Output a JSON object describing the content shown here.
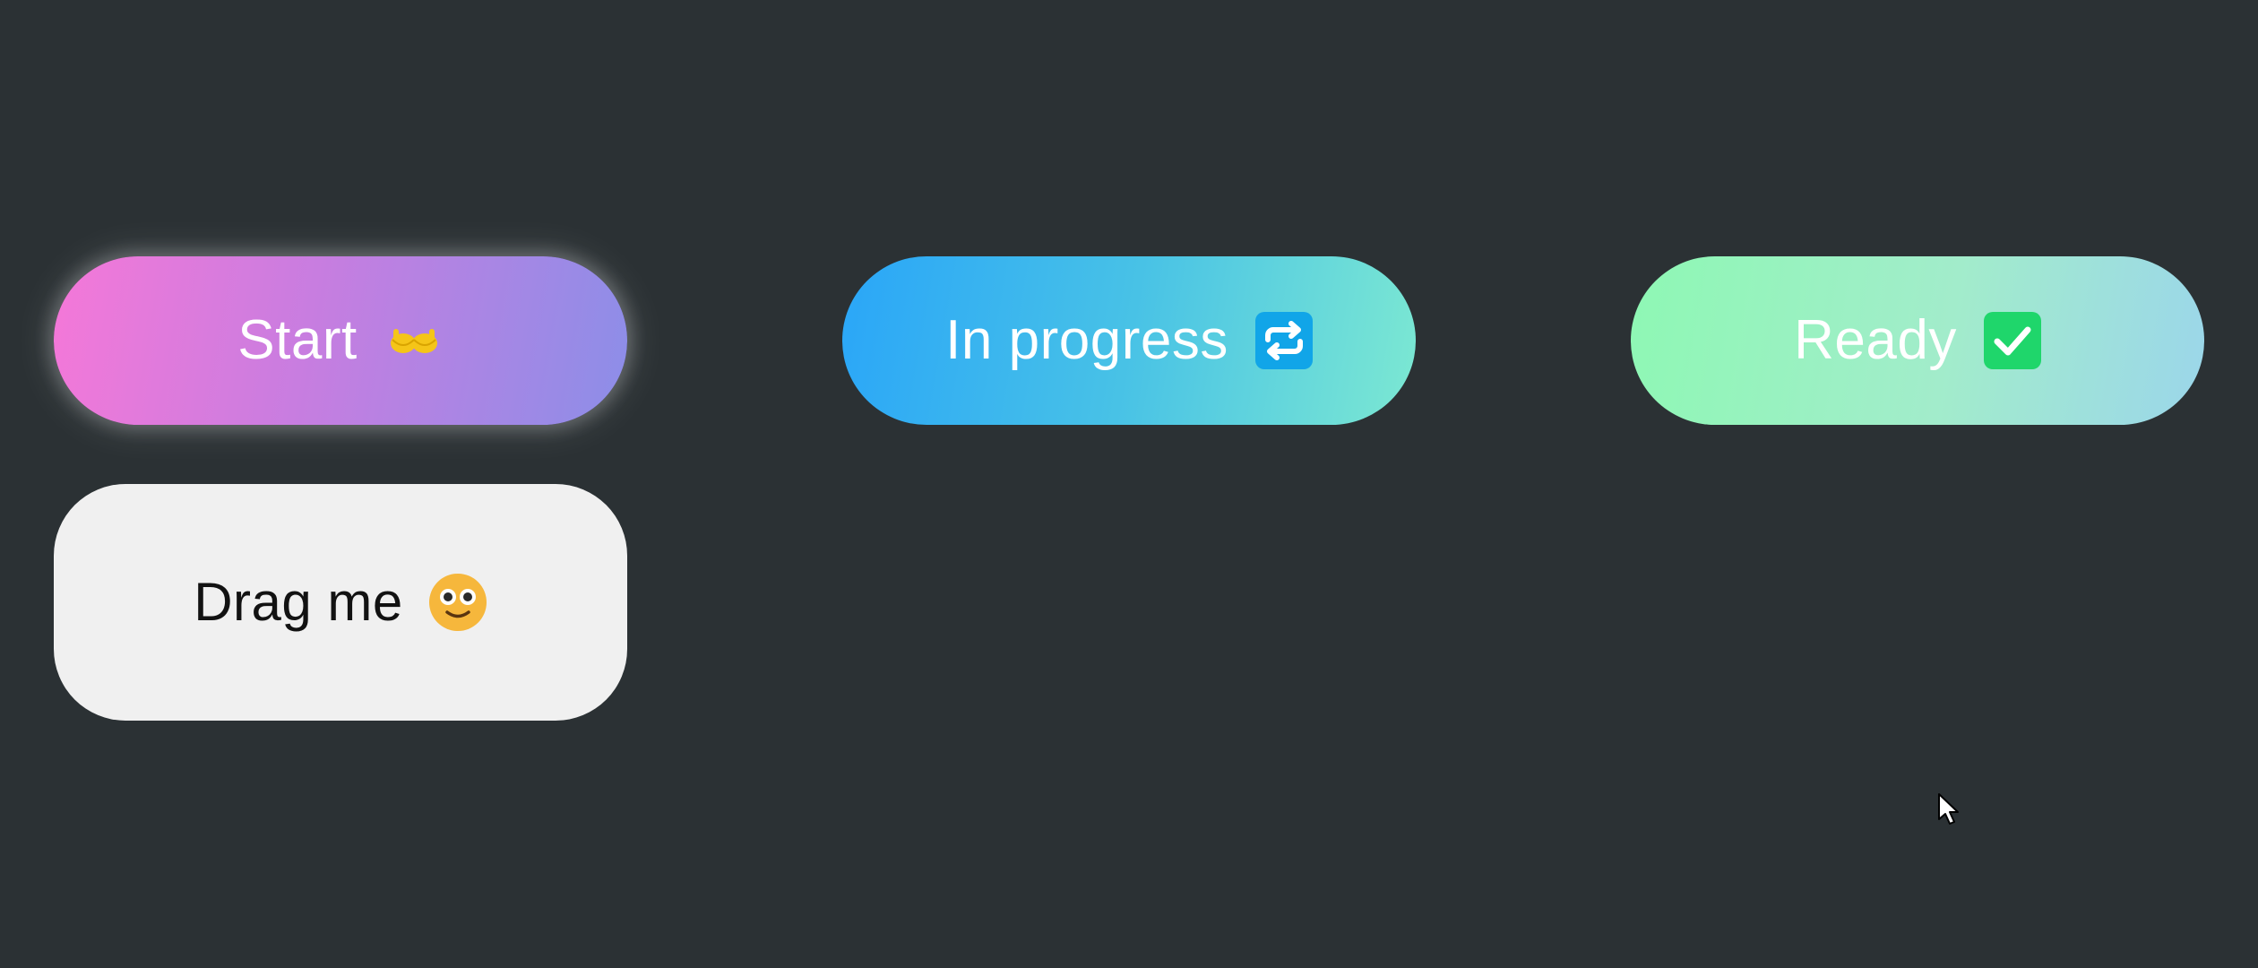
{
  "cards": {
    "start": {
      "label": "Start",
      "icon": "hands-icon"
    },
    "drag": {
      "label": "Drag me",
      "icon": "smiley-face-icon"
    },
    "in_progress": {
      "label": "In progress",
      "icon": "repeat-icon"
    },
    "ready": {
      "label": "Ready",
      "icon": "check-mark-icon"
    }
  },
  "colors": {
    "background": "#2b3134",
    "start_gradient": [
      "#f578d8",
      "#8c8ee8"
    ],
    "in_progress_gradient": [
      "#2aa6f8",
      "#7ce8d2"
    ],
    "ready_gradient": [
      "#8ef8b4",
      "#9bd6ea"
    ],
    "drag_card": "#f0f0f0",
    "repeat_icon_bg": "#11a5e8",
    "check_icon_bg": "#1fd66b",
    "hands_icon": "#f5c518"
  }
}
